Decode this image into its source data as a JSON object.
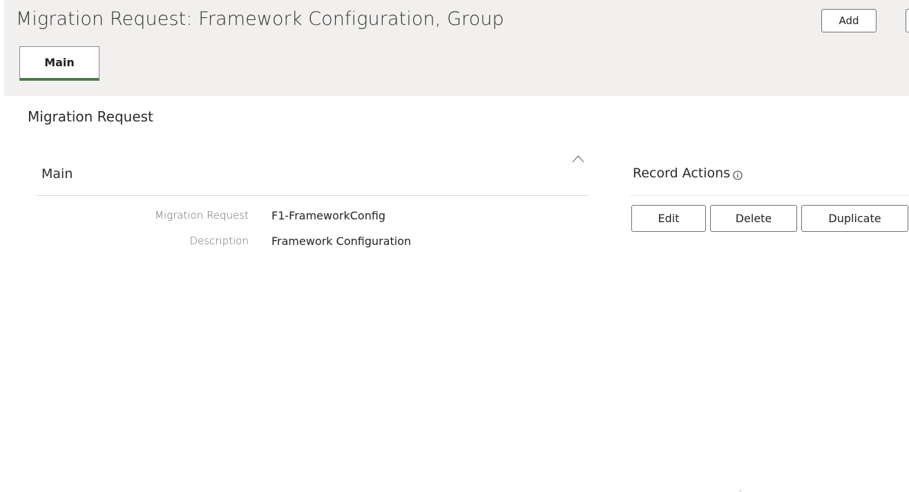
{
  "header": {
    "title": "Migration Request: Framework Configuration, Group",
    "add_label": "Add",
    "tabs": [
      {
        "label": "Main",
        "selected": true
      }
    ]
  },
  "section": {
    "title": "Migration Request"
  },
  "main_panel": {
    "title": "Main",
    "collapse_icon": "chevron-up-icon",
    "fields": [
      {
        "label": "Migration Request",
        "value": "F1-FrameworkConfig"
      },
      {
        "label": "Description",
        "value": "Framework Configuration"
      }
    ]
  },
  "record_actions": {
    "title": "Record Actions",
    "info_icon": "info-icon",
    "buttons": {
      "edit": "Edit",
      "delete": "Delete",
      "duplicate": "Duplicate"
    }
  },
  "colors": {
    "header_bg": "#f1f0ee",
    "tab_underline": "#4a7a4a",
    "border": "#6e6e6e",
    "label_text": "#6a6a6a"
  }
}
